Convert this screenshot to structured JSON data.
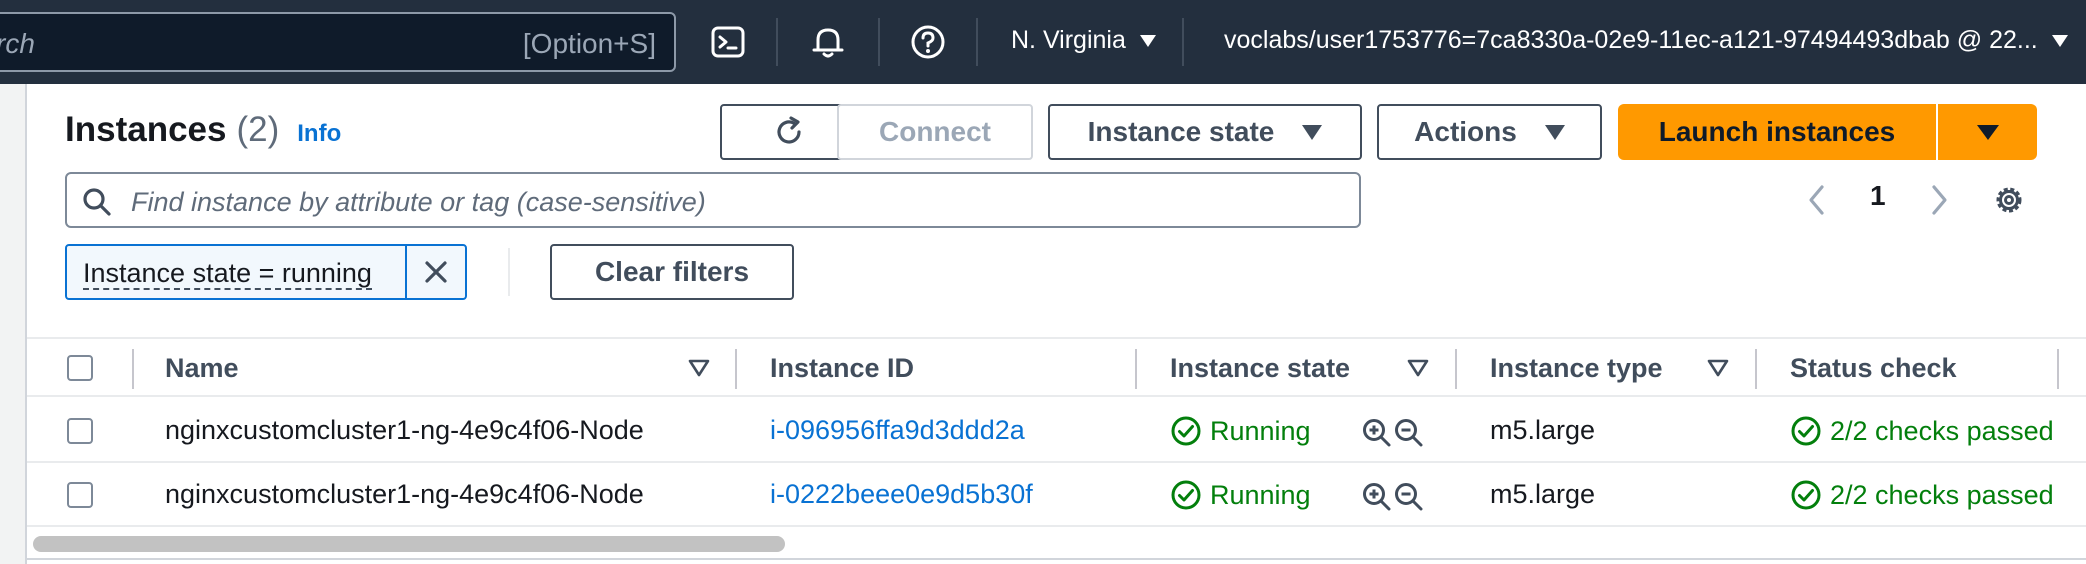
{
  "topnav": {
    "search_placeholder": "rch",
    "search_shortcut": "[Option+S]",
    "icons": [
      "cloudshell-icon",
      "bell-icon",
      "help-icon"
    ],
    "region": "N. Virginia",
    "account": "voclabs/user1753776=7ca8330a-02e9-11ec-a121-97494493dbab @ 22..."
  },
  "header": {
    "title": "Instances",
    "count": "(2)",
    "info": "Info"
  },
  "toolbar": {
    "refresh_icon": "refresh-icon",
    "connect": "Connect",
    "instance_state": "Instance state",
    "actions": "Actions",
    "launch": "Launch instances"
  },
  "filter": {
    "placeholder": "Find instance by attribute or tag (case-sensitive)",
    "token": "Instance state = running",
    "clear": "Clear filters"
  },
  "pagination": {
    "page": "1"
  },
  "table": {
    "columns": [
      "Name",
      "Instance ID",
      "Instance state",
      "Instance type",
      "Status check"
    ],
    "rows": [
      {
        "name": "nginxcustomcluster1-ng-4e9c4f06-Node",
        "id": "i-096956ffa9d3ddd2a",
        "state": "Running",
        "type": "m5.large",
        "status": "2/2 checks passed"
      },
      {
        "name": "nginxcustomcluster1-ng-4e9c4f06-Node",
        "id": "i-0222beee0e9d5b30f",
        "state": "Running",
        "type": "m5.large",
        "status": "2/2 checks passed"
      }
    ]
  },
  "colors": {
    "nav_bg": "#232f3e",
    "primary": "#ff9900",
    "link": "#0972d3",
    "success": "#037f0c"
  }
}
